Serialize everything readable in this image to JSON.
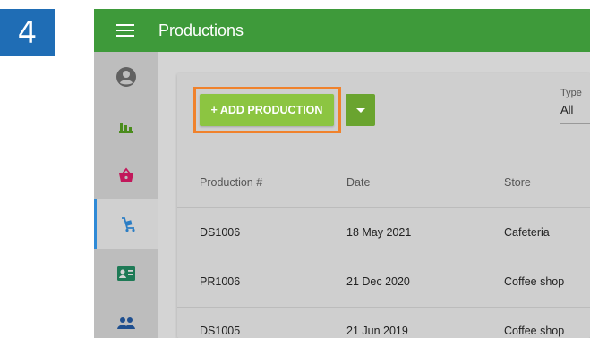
{
  "step_number": "4",
  "app": {
    "title": "Productions"
  },
  "sidebar": {
    "items": [
      {
        "icon": "account-circle-icon",
        "active": false
      },
      {
        "icon": "bar-chart-icon",
        "active": false
      },
      {
        "icon": "basket-icon",
        "active": false
      },
      {
        "icon": "hand-truck-icon",
        "active": true
      },
      {
        "icon": "contact-card-icon",
        "active": false
      },
      {
        "icon": "people-icon",
        "active": false
      }
    ]
  },
  "toolbar": {
    "add_label": "+ ADD PRODUCTION",
    "type_label": "Type",
    "type_value": "All"
  },
  "table": {
    "columns": [
      "Production #",
      "Date",
      "Store"
    ],
    "rows": [
      [
        "DS1006",
        "18 May 2021",
        "Cafeteria"
      ],
      [
        "PR1006",
        "21 Dec 2020",
        "Coffee shop"
      ],
      [
        "DS1005",
        "21 Jun 2019",
        "Coffee shop"
      ]
    ]
  },
  "colors": {
    "appbar": "#3e9a3a",
    "add_button": "#8cc541",
    "highlight": "#f0822c",
    "step_badge": "#1f6db5",
    "active_indicator": "#2f8ad6"
  }
}
